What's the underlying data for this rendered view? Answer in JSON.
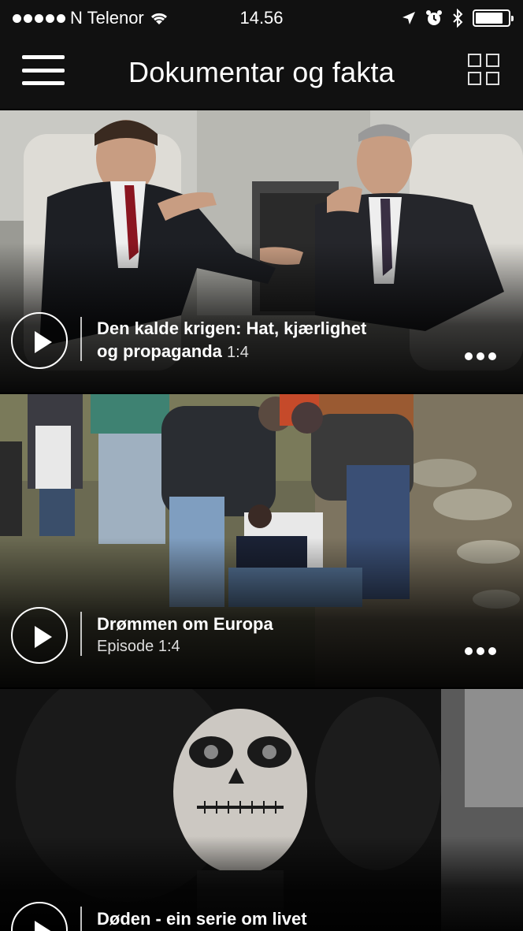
{
  "status_bar": {
    "carrier": "N Telenor",
    "time": "14.56",
    "icons": [
      "signal-dots-icon",
      "wifi-icon",
      "location-arrow-icon",
      "alarm-clock-icon",
      "bluetooth-icon",
      "battery-icon"
    ]
  },
  "nav": {
    "title": "Dokumentar og fakta",
    "menu_icon": "hamburger-menu-icon",
    "grid_icon": "grid-view-icon"
  },
  "cards": [
    {
      "title_line1": "Den kalde krigen: Hat, kjærlighet",
      "title_line2": "og propaganda",
      "episode": "1:4",
      "image": "two-men-talking-in-armchairs-photo"
    },
    {
      "title": "Drømmen om Europa",
      "subtitle": "Episode 1:4",
      "image": "migrants-outdoors-photo"
    },
    {
      "title": "Døden - ein serie om livet",
      "image": "skull-face-paint-photo"
    }
  ],
  "colors": {
    "bar_background": "#111111",
    "text": "#ffffff"
  }
}
